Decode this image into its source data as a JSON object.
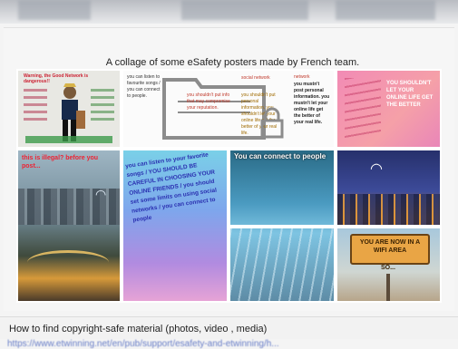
{
  "caption": "A collage of some eSafety posters made by French team.",
  "footer": {
    "title": "How to find copyright-safe material (photos, video , media)",
    "link": "https://www.etwinning.net/en/pub/support/esafety-and-etwinning/h..."
  },
  "posters": {
    "p1_header": "Warning, the Good Network is dangerous!!",
    "p2_text": "you can listen to favourite songs / you can connect to people.",
    "p2_mid": "you shouldn't put info that may compromise your reputation.",
    "p2_right_top": "social network",
    "p2_right_mid": "you shouldn't put personal information. you shouldn't let your online life get the better of your real life.",
    "p3_label": "network",
    "p3_text": "you mustn't post personal information. you mustn't let your online life get the better of your real life.",
    "p4_text": "YOU SHOULDN'T LET YOUR ONLINE LIFE GET THE BETTER",
    "p5_text": "this is illegal? before you post...",
    "p6_text": "you can listen to your favorite songs / YOU SHOULD BE CAREFUL IN CHOOSING YOUR ONLINE FRIENDS / you should set some limits on using social networks / you can connect to people",
    "p7_text": "You can connect to people",
    "p8_sign": "YOU ARE NOW IN A WIFI AREA",
    "p8_sub": "SO..."
  },
  "colors": {
    "card_bg": "#f6f6f6",
    "link": "#6a7fc8"
  }
}
